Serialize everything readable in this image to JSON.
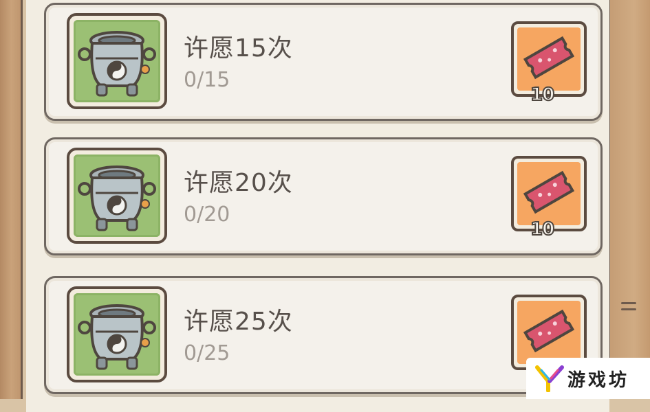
{
  "tasks": [
    {
      "title": "许愿15次",
      "progress": "0/15",
      "reward_count": "10",
      "icon": "wishing-cauldron-icon",
      "reward_icon": "ticket-icon"
    },
    {
      "title": "许愿20次",
      "progress": "0/20",
      "reward_count": "10",
      "icon": "wishing-cauldron-icon",
      "reward_icon": "ticket-icon"
    },
    {
      "title": "许愿25次",
      "progress": "0/25",
      "reward_count": "",
      "icon": "wishing-cauldron-icon",
      "reward_icon": "ticket-icon"
    }
  ],
  "watermark": {
    "text": "游戏坊",
    "icon": "colorful-y-logo-icon"
  },
  "colors": {
    "card_background": "#f4f1eb",
    "icon_background_green": "#9bc074",
    "reward_background_orange": "#f6a661",
    "ticket_pink": "#d9556e",
    "frame_dark": "#5b4b40",
    "title_text": "#57504b",
    "progress_text": "#a19a93"
  }
}
